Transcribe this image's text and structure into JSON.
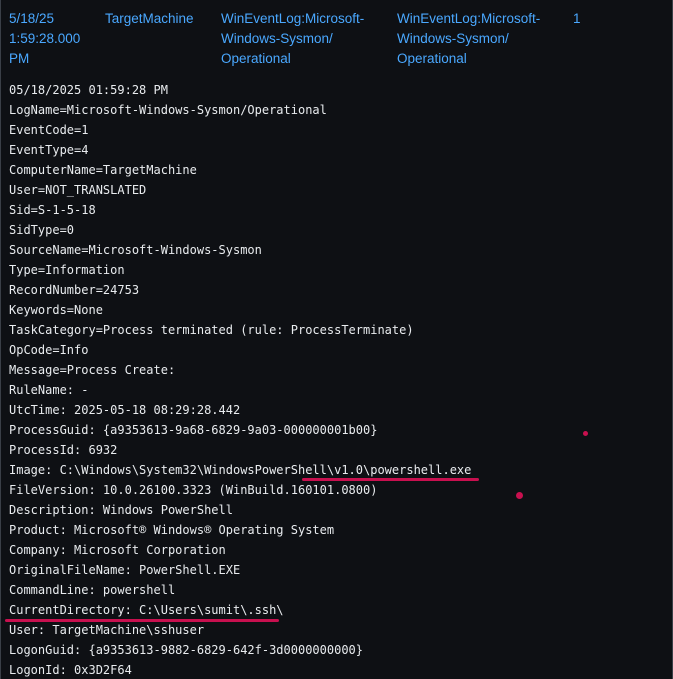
{
  "event_header": {
    "time": "5/18/25\n1:59:28.000\nPM",
    "host": "TargetMachine",
    "source": "WinEventLog:Microsoft-\nWindows-Sysmon/\nOperational",
    "sourcetype": "WinEventLog:Microsoft-\nWindows-Sysmon/\nOperational",
    "count": "1"
  },
  "raw_event_lines": [
    "05/18/2025 01:59:28 PM",
    "LogName=Microsoft-Windows-Sysmon/Operational",
    "EventCode=1",
    "EventType=4",
    "ComputerName=TargetMachine",
    "User=NOT_TRANSLATED",
    "Sid=S-1-5-18",
    "SidType=0",
    "SourceName=Microsoft-Windows-Sysmon",
    "Type=Information",
    "RecordNumber=24753",
    "Keywords=None",
    "TaskCategory=Process terminated (rule: ProcessTerminate)",
    "OpCode=Info",
    "Message=Process Create:",
    "RuleName: -",
    "UtcTime: 2025-05-18 08:29:28.442",
    "ProcessGuid: {a9353613-9a68-6829-9a03-000000001b00}",
    "ProcessId: 6932",
    "Image: C:\\Windows\\System32\\WindowsPowerShell\\v1.0\\powershell.exe",
    "FileVersion: 10.0.26100.3323 (WinBuild.160101.0800)",
    "Description: Windows PowerShell",
    "Product: Microsoft® Windows® Operating System",
    "Company: Microsoft Corporation",
    "OriginalFileName: PowerShell.EXE",
    "CommandLine: powershell",
    "CurrentDirectory: C:\\Users\\sumit\\.ssh\\",
    "User: TargetMachine\\sshuser",
    "LogonGuid: {a9353613-9882-6829-642f-3d0000000000}",
    "LogonId: 0x3D2F64"
  ],
  "colors": {
    "background": "#0e1014",
    "header_link": "#4aa8ff",
    "text": "#e9ecef",
    "annotation": "#c8104f"
  }
}
